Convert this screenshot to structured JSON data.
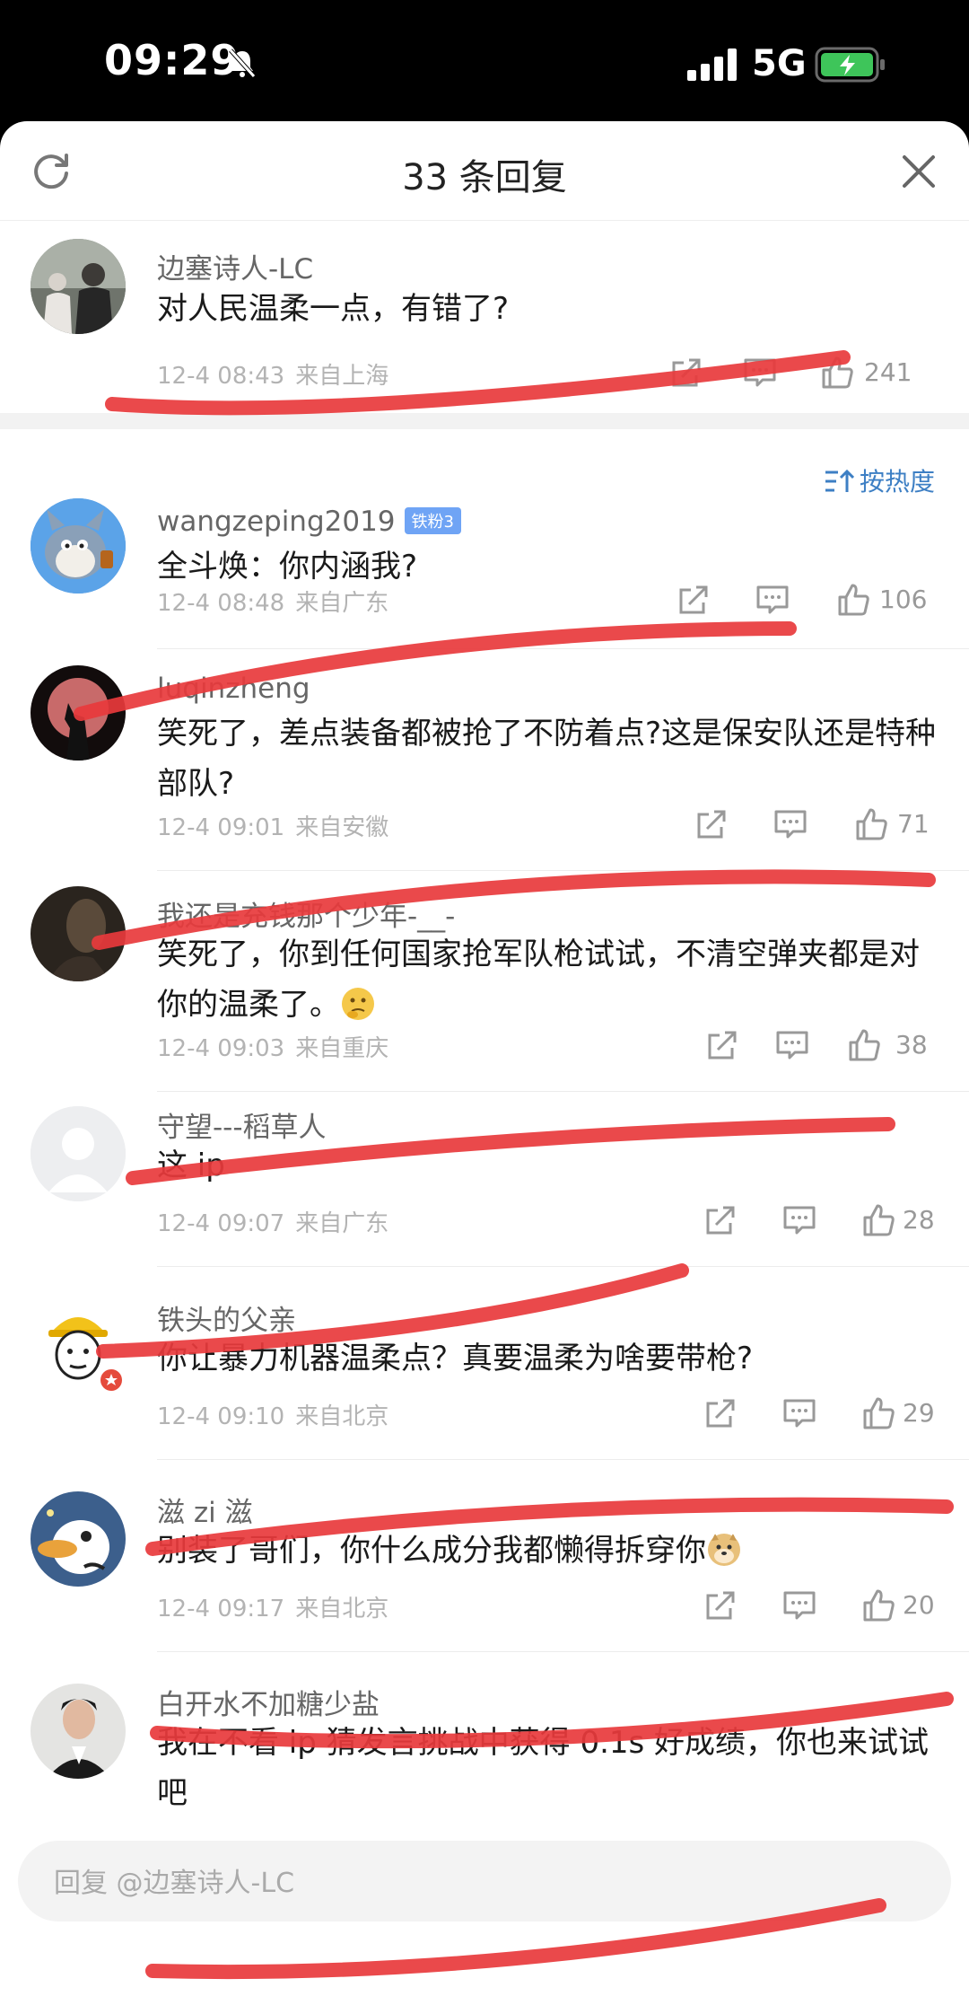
{
  "status_bar": {
    "time": "09:29",
    "network": "5G"
  },
  "header": {
    "title": "33 条回复"
  },
  "top_comment": {
    "username": "边塞诗人-LC",
    "content": "对人民温柔一点，有错了?",
    "time": "12-4 08:43",
    "location": "来自上海",
    "likes": "241"
  },
  "sort": {
    "label": "按热度"
  },
  "replies": [
    {
      "username": "wangzeping2019",
      "badge": "铁粉3",
      "content": "全斗焕：你内涵我?",
      "time": "12-4 08:48",
      "location": "来自广东",
      "likes": "106"
    },
    {
      "username": "luqinzheng",
      "content": "笑死了，差点装备都被抢了不防着点?这是保安队还是特种部队?",
      "time": "12-4 09:01",
      "location": "来自安徽",
      "likes": "71"
    },
    {
      "username": "我还是充钱那个少年-__-",
      "content": "笑死了，你到任何国家抢军队枪试试，不清空弹夹都是对你的温柔了。",
      "time": "12-4 09:03",
      "location": "来自重庆",
      "likes": "38"
    },
    {
      "username": "守望---稻草人",
      "content": "这 ip",
      "time": "12-4 09:07",
      "location": "来自广东",
      "likes": "28"
    },
    {
      "username": "铁头的父亲",
      "content": "你让暴力机器温柔点？真要温柔为啥要带枪?",
      "time": "12-4 09:10",
      "location": "来自北京",
      "likes": "29"
    },
    {
      "username": "滋 zi 滋",
      "content": "别装了哥们，你什么成分我都懒得拆穿你",
      "time": "12-4 09:17",
      "location": "来自北京",
      "likes": "20"
    },
    {
      "username": "白开水不加糖少盐",
      "content": "我在不看 ip 猜发言挑战中获得 0.1s 好成绩，你也来试试吧"
    }
  ],
  "reply_bar": {
    "placeholder": "回复 @边塞诗人-LC"
  },
  "icons": [
    "refresh-icon",
    "close-icon",
    "mute-icon",
    "signal-icon",
    "battery-icon",
    "sort-icon",
    "share-icon",
    "comment-icon",
    "like-icon"
  ],
  "colors": {
    "accent": "#3d7fc4",
    "annotation_line": "#e8393c",
    "battery": "#3ec55a"
  }
}
